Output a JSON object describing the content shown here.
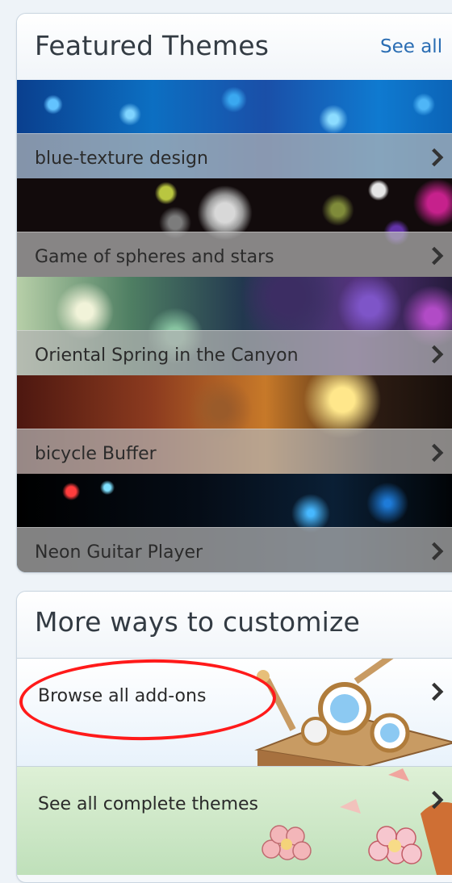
{
  "featured": {
    "title": "Featured Themes",
    "see_all_label": "See all",
    "themes": [
      {
        "name": "blue-texture design"
      },
      {
        "name": "Game of spheres and stars"
      },
      {
        "name": "Oriental Spring in the Canyon"
      },
      {
        "name": "bicycle Buffer"
      },
      {
        "name": "Neon Guitar Player"
      }
    ]
  },
  "more_ways": {
    "title": "More ways to customize",
    "items": [
      {
        "label": "Browse all add-ons"
      },
      {
        "label": "See all complete themes"
      }
    ]
  },
  "icons": {
    "row_arrow": "chevron-right-icon",
    "annotation": "red-ellipse"
  },
  "colors": {
    "link": "#2a6db3",
    "annotation": "#ff1a1a"
  }
}
